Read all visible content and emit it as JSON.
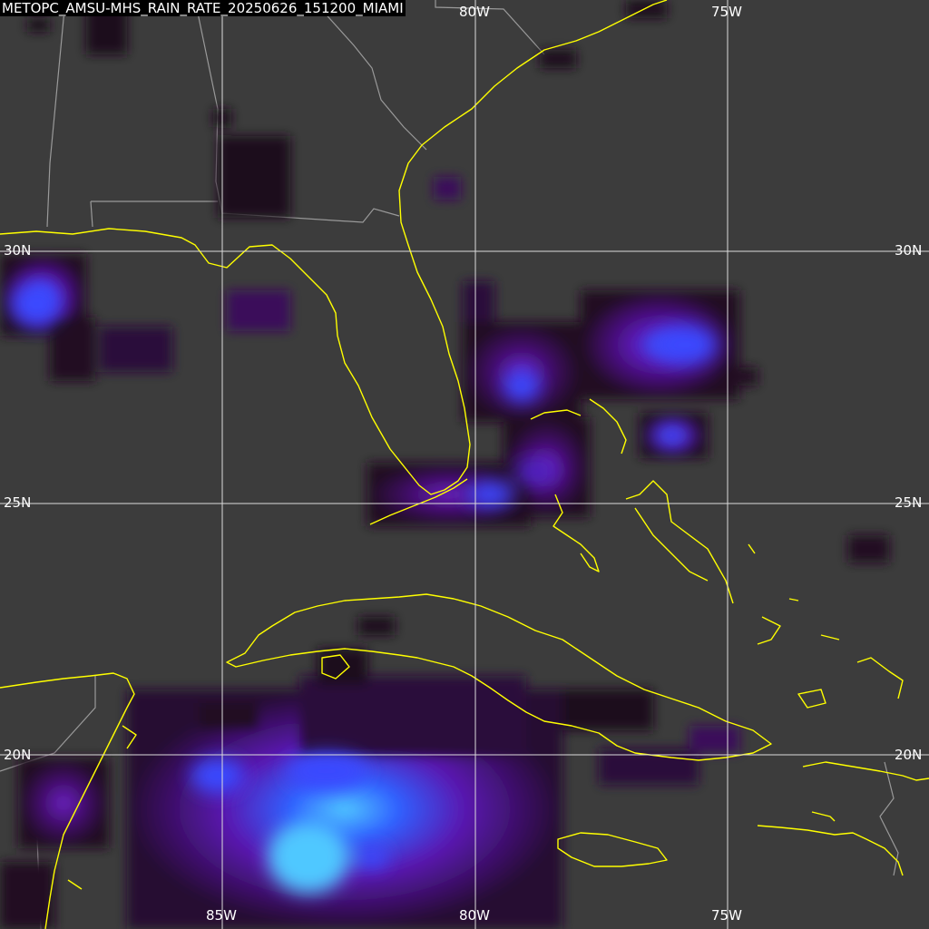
{
  "title": "METOPC_AMSU-MHS_RAIN_RATE_20250626_151200_MIAMI",
  "graticule": {
    "top_labels": {
      "lon80": "80W",
      "lon75": "75W"
    },
    "bottom_labels": {
      "lon85": "85W",
      "lon80": "80W",
      "lon75": "75W"
    },
    "left_labels": {
      "lat30": "30N",
      "lat25": "25N",
      "lat20": "20N"
    },
    "right_labels": {
      "lat30": "30N",
      "lat25": "25N",
      "lat20": "20N"
    }
  },
  "colors": {
    "background": "#3c3c3c",
    "coastline": "#ffff00",
    "political_border": "#9a9a9a",
    "grid": "#dcdcdc",
    "rain_light": "#240a24",
    "rain_moderate": "#5a1090",
    "rain_heavy": "#2a40ff",
    "rain_intense": "#40b0ff"
  },
  "rain_cells": [
    {
      "id": "gulf-west",
      "intensity": "heavy"
    },
    {
      "id": "florida-panhandle",
      "intensity": "light"
    },
    {
      "id": "georgia-north",
      "intensity": "light"
    },
    {
      "id": "atlantic-east",
      "intensity": "heavy"
    },
    {
      "id": "bahamas",
      "intensity": "moderate"
    },
    {
      "id": "florida-keys",
      "intensity": "moderate"
    },
    {
      "id": "caribbean-south",
      "intensity": "intense"
    },
    {
      "id": "yucatan",
      "intensity": "moderate"
    },
    {
      "id": "cuba-east",
      "intensity": "light"
    },
    {
      "id": "atlantic-far-east",
      "intensity": "light"
    }
  ]
}
